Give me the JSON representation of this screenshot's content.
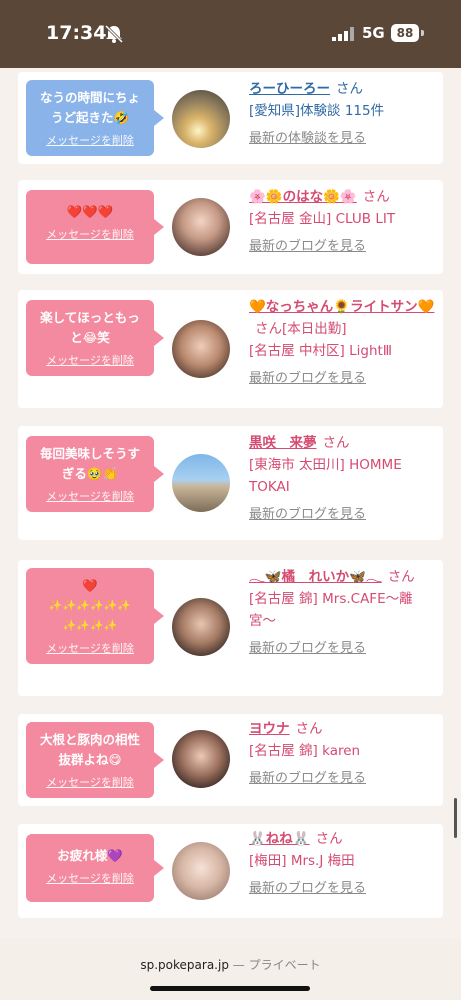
{
  "status": {
    "time": "17:34",
    "network": "5G",
    "battery": "88"
  },
  "cards": [
    {
      "bubble_lines": [
        "なうの時間にちょ",
        "うど起きた🤣"
      ],
      "delete": "メッセージを削除",
      "name": "ろーひーろー",
      "san": "さん",
      "name_cont": "",
      "location": "[愛知県]体験談 115件",
      "more": "最新の体験談を見る"
    },
    {
      "bubble_lines": [
        "❤️❤️❤️"
      ],
      "delete": "メッセージを削除",
      "name": "🌸🌼のはな🌼🌸",
      "san": "さん",
      "name_cont": "",
      "location": "[名古屋 金山] CLUB LIT",
      "more": "最新のブログを見る"
    },
    {
      "bubble_lines": [
        "楽してほっともっ",
        "と😂笑"
      ],
      "delete": "メッセージを削除",
      "name": "🧡なっちゃん🌻ライトサン🧡",
      "san": "さん",
      "name_cont": "[本日出勤]",
      "location": "[名古屋 中村区] LightⅢ",
      "more": "最新のブログを見る"
    },
    {
      "bubble_lines": [
        "毎回美味しそうす",
        "ぎる🥹👏"
      ],
      "delete": "メッセージを削除",
      "name": "黒咲　来夢",
      "san": "さん",
      "name_cont": "",
      "location": "[東海市 太田川] HOMME TOKAI",
      "more": "最新のブログを見る"
    },
    {
      "bubble_lines": [
        "❤️",
        "✨✨✨✨✨✨",
        "✨✨✨✨"
      ],
      "delete": "メッセージを削除",
      "name": "𓂃🦋橘　れいか🦋𓂃",
      "san": "さん",
      "name_cont": "",
      "location": "[名古屋 錦] Mrs.CAFE〜離宮〜",
      "more": "最新のブログを見る"
    },
    {
      "bubble_lines": [
        "大根と豚肉の相性",
        "抜群よね😋"
      ],
      "delete": "メッセージを削除",
      "name": "ヨウナ",
      "san": "さん",
      "name_cont": "",
      "location": "[名古屋 錦] karen",
      "more": "最新のブログを見る"
    },
    {
      "bubble_lines": [
        "お疲れ様💜"
      ],
      "delete": "メッセージを削除",
      "name": "🐰ねね🐰",
      "san": "さん",
      "name_cont": "",
      "location": "[梅田] Mrs.J 梅田",
      "more": "最新のブログを見る"
    }
  ],
  "footer": {
    "url": "sp.pokepara.jp",
    "separator": "—",
    "mode": "プライベート"
  },
  "colors": {
    "pink": "#f48aa0",
    "blue": "#8ab3ea",
    "name_pink": "#d54b72",
    "name_blue": "#2f6aa4",
    "status_bg": "#5a4738"
  }
}
